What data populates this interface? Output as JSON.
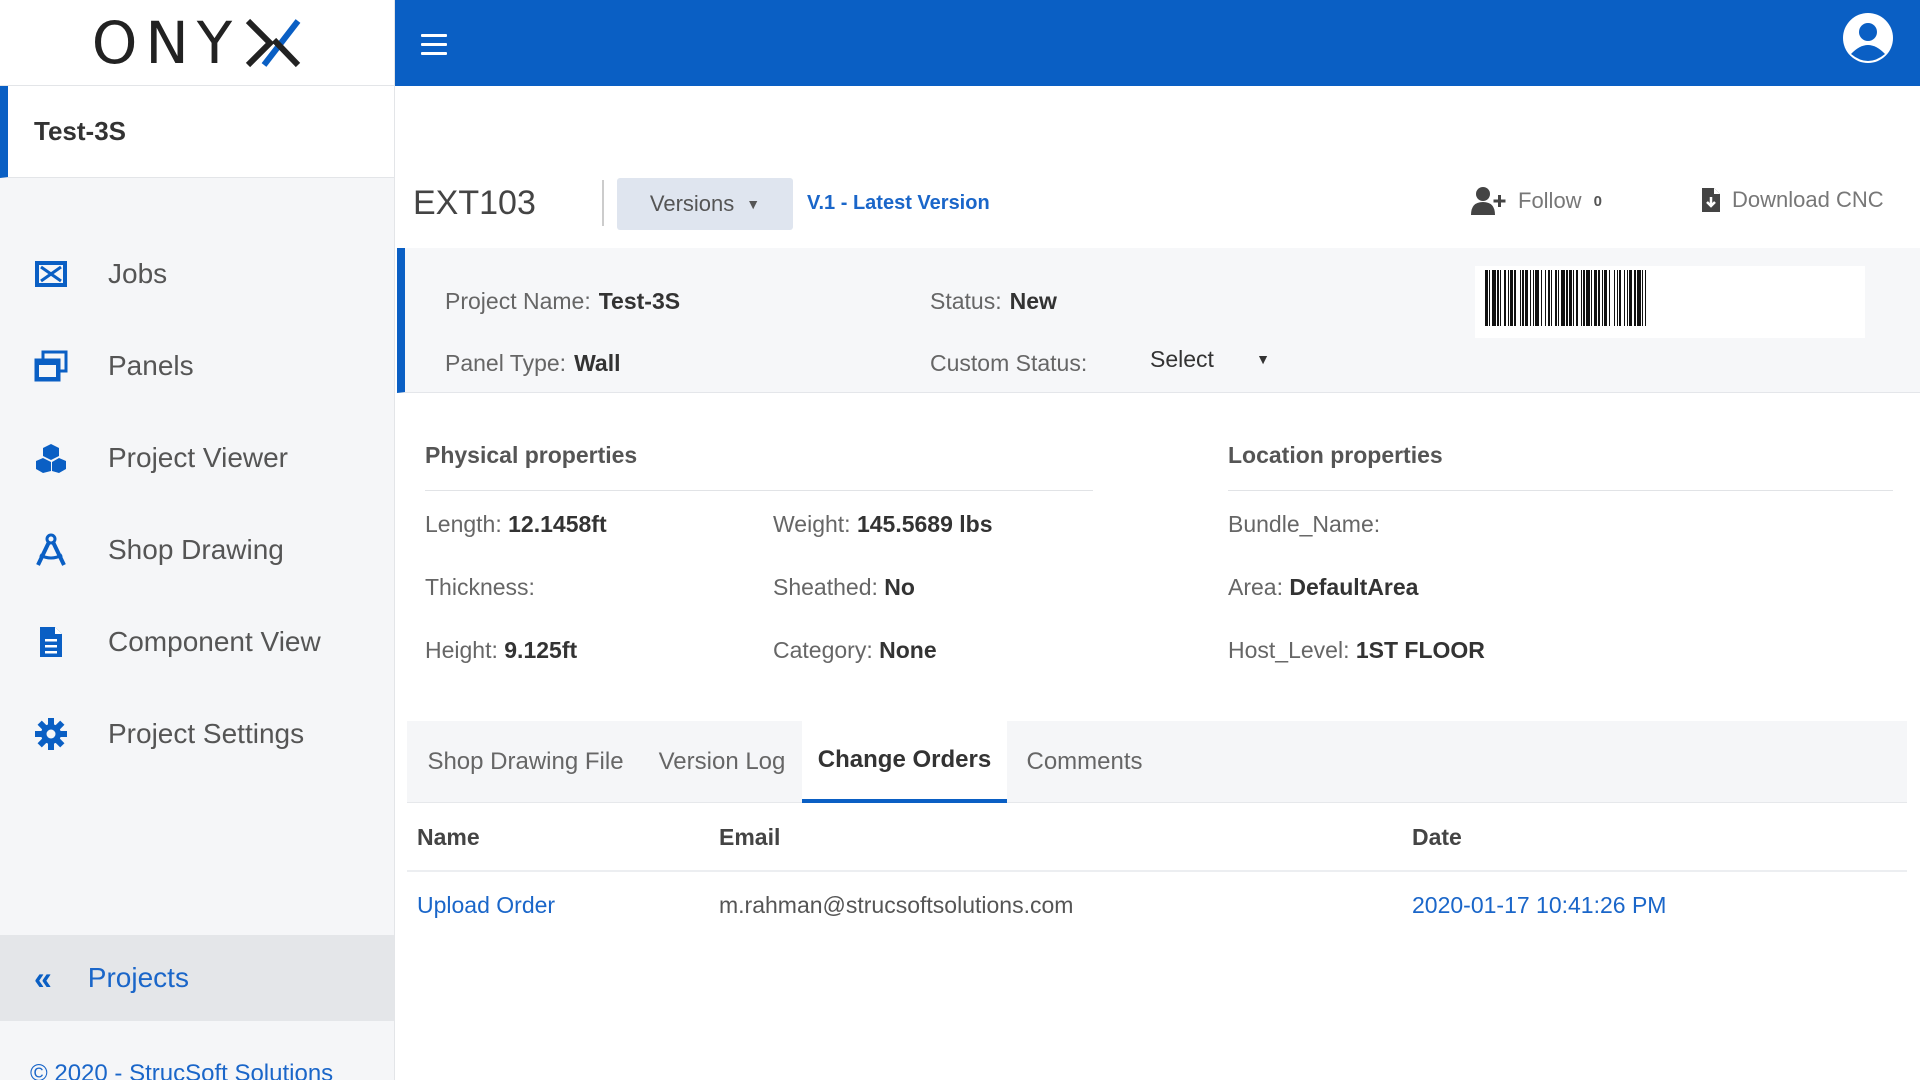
{
  "app": {
    "logo_text": "ONY",
    "brand_color": "#0a5fc4"
  },
  "sidebar": {
    "project_name": "Test-3S",
    "items": [
      {
        "label": "Jobs",
        "icon": "jobs-icon"
      },
      {
        "label": "Panels",
        "icon": "panels-icon"
      },
      {
        "label": "Project Viewer",
        "icon": "project-viewer-icon"
      },
      {
        "label": "Shop Drawing",
        "icon": "shop-drawing-icon"
      },
      {
        "label": "Component View",
        "icon": "component-view-icon"
      },
      {
        "label": "Project Settings",
        "icon": "gear-icon"
      }
    ],
    "projects_link": "Projects",
    "copyright": "© 2020 - StrucSoft Solutions"
  },
  "header": {
    "panel_id": "EXT103",
    "versions_label": "Versions",
    "version_link": "V.1 - Latest Version",
    "follow_label": "Follow",
    "follow_count": "0",
    "download_label": "Download CNC"
  },
  "info": {
    "project_name_label": "Project Name:",
    "project_name_value": "Test-3S",
    "panel_type_label": "Panel Type:",
    "panel_type_value": "Wall",
    "status_label": "Status:",
    "status_value": "New",
    "custom_status_label": "Custom Status:",
    "custom_status_value": "Select"
  },
  "physical": {
    "title": "Physical properties",
    "length_label": "Length:",
    "length_value": "12.1458ft",
    "thickness_label": "Thickness:",
    "thickness_value": "",
    "height_label": "Height:",
    "height_value": "9.125ft",
    "weight_label": "Weight:",
    "weight_value": "145.5689 lbs",
    "sheathed_label": "Sheathed:",
    "sheathed_value": "No",
    "category_label": "Category:",
    "category_value": "None"
  },
  "location": {
    "title": "Location properties",
    "bundle_label": "Bundle_Name:",
    "bundle_value": "",
    "area_label": "Area:",
    "area_value": "DefaultArea",
    "host_label": "Host_Level:",
    "host_value": "1ST FLOOR"
  },
  "tabs": [
    {
      "label": "Shop Drawing File"
    },
    {
      "label": "Version Log"
    },
    {
      "label": "Change Orders",
      "active": true
    },
    {
      "label": "Comments"
    }
  ],
  "table": {
    "columns": [
      "Name",
      "Email",
      "Date"
    ],
    "rows": [
      {
        "name": "Upload Order",
        "email": "m.rahman@strucsoftsolutions.com",
        "date": "2020-01-17 10:41:26 PM"
      }
    ]
  }
}
